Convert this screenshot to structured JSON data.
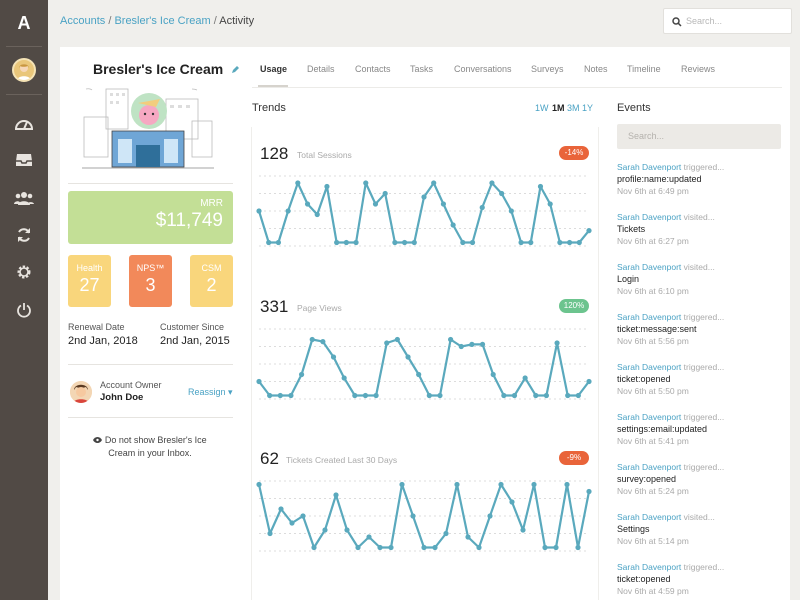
{
  "sidebar": {
    "logo": "A",
    "nav": [
      {
        "name": "dashboard-icon"
      },
      {
        "name": "inbox-icon"
      },
      {
        "name": "users-icon"
      },
      {
        "name": "refresh-icon"
      },
      {
        "name": "settings-icon"
      },
      {
        "name": "power-icon"
      }
    ]
  },
  "breadcrumb": {
    "items": [
      "Accounts",
      "Bresler's Ice Cream",
      "Activity"
    ],
    "separator": "/"
  },
  "search": {
    "placeholder": "Search..."
  },
  "account": {
    "name": "Bresler's Ice Cream",
    "mrr_label": "MRR",
    "mrr_value": "$11,749",
    "metrics": [
      {
        "label": "Health",
        "value": "27",
        "color": "#f9d67c"
      },
      {
        "label": "NPS™",
        "value": "3",
        "color": "#f2895a"
      },
      {
        "label": "CSM",
        "value": "2",
        "color": "#f9d67c"
      }
    ],
    "renewal_label": "Renewal Date",
    "renewal_value": "2nd Jan, 2018",
    "since_label": "Customer Since",
    "since_value": "2nd Jan, 2015",
    "owner_label": "Account Owner",
    "owner_name": "John Doe",
    "reassign_label": "Reassign ▾",
    "inbox_note": "Do not show Bresler's Ice Cream in your Inbox."
  },
  "tabs": [
    "Usage",
    "Details",
    "Contacts",
    "Tasks",
    "Conversations",
    "Surveys",
    "Notes",
    "Timeline",
    "Reviews"
  ],
  "active_tab": "Usage",
  "trends": {
    "title": "Trends",
    "ranges": [
      "1W",
      "1M",
      "3M",
      "1Y"
    ],
    "active_range": "1M",
    "accent": "#5aa9bd"
  },
  "chart_data": [
    {
      "type": "line",
      "value": "128",
      "title": "Total Sessions",
      "badge": "-14%",
      "badge_color": "#e9643a",
      "values": [
        0.5,
        0.05,
        0.05,
        0.5,
        0.9,
        0.6,
        0.45,
        0.85,
        0.05,
        0.05,
        0.05,
        0.9,
        0.6,
        0.75,
        0.05,
        0.05,
        0.05,
        0.7,
        0.9,
        0.6,
        0.3,
        0.05,
        0.05,
        0.55,
        0.9,
        0.75,
        0.5,
        0.05,
        0.05,
        0.85,
        0.6,
        0.05,
        0.05,
        0.05,
        0.22
      ]
    },
    {
      "type": "line",
      "value": "331",
      "title": "Page Views",
      "badge": "120%",
      "badge_color": "#6cc48e",
      "values": [
        0.25,
        0.05,
        0.05,
        0.05,
        0.35,
        0.85,
        0.82,
        0.6,
        0.3,
        0.05,
        0.05,
        0.05,
        0.8,
        0.85,
        0.6,
        0.35,
        0.05,
        0.05,
        0.85,
        0.75,
        0.78,
        0.78,
        0.35,
        0.05,
        0.05,
        0.3,
        0.05,
        0.05,
        0.8,
        0.05,
        0.05,
        0.25
      ]
    },
    {
      "type": "line",
      "value": "62",
      "title": "Tickets Created Last 30 Days",
      "badge": "-9%",
      "badge_color": "#e9643a",
      "values": [
        0.95,
        0.25,
        0.6,
        0.4,
        0.5,
        0.05,
        0.3,
        0.8,
        0.3,
        0.05,
        0.2,
        0.05,
        0.05,
        0.95,
        0.5,
        0.05,
        0.05,
        0.25,
        0.95,
        0.2,
        0.05,
        0.5,
        0.95,
        0.7,
        0.3,
        0.95,
        0.05,
        0.05,
        0.95,
        0.05,
        0.85
      ]
    }
  ],
  "events": {
    "title": "Events",
    "search_placeholder": "Search...",
    "items": [
      {
        "user": "Sarah Davenport",
        "action": "triggered...",
        "target": "profile:name:updated",
        "time": "Nov 6th at 6:49 pm"
      },
      {
        "user": "Sarah Davenport",
        "action": "visited...",
        "target": "Tickets",
        "time": "Nov 6th at 6:27 pm"
      },
      {
        "user": "Sarah Davenport",
        "action": "visited...",
        "target": "Login",
        "time": "Nov 6th at 6:10 pm"
      },
      {
        "user": "Sarah Davenport",
        "action": "triggered...",
        "target": "ticket:message:sent",
        "time": "Nov 6th at 5:56 pm"
      },
      {
        "user": "Sarah Davenport",
        "action": "triggered...",
        "target": "ticket:opened",
        "time": "Nov 6th at 5:50 pm"
      },
      {
        "user": "Sarah Davenport",
        "action": "triggered...",
        "target": "settings:email:updated",
        "time": "Nov 6th at 5:41 pm"
      },
      {
        "user": "Sarah Davenport",
        "action": "triggered...",
        "target": "survey:opened",
        "time": "Nov 6th at 5:24 pm"
      },
      {
        "user": "Sarah Davenport",
        "action": "visited...",
        "target": "Settings",
        "time": "Nov 6th at 5:14 pm"
      },
      {
        "user": "Sarah Davenport",
        "action": "triggered...",
        "target": "ticket:opened",
        "time": "Nov 6th at 4:59 pm"
      }
    ]
  }
}
